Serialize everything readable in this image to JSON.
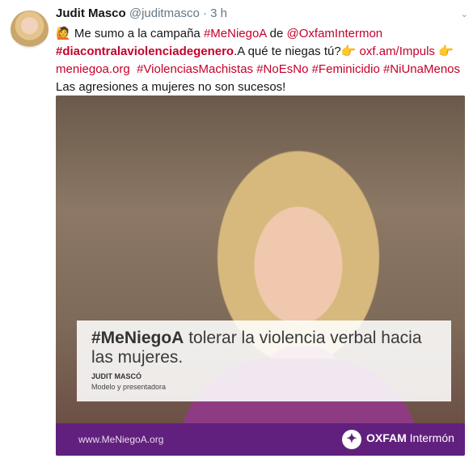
{
  "tweet": {
    "author_name": "Judit Masco",
    "handle": "@juditmasco",
    "separator": "·",
    "time": "3 h",
    "text": {
      "emoji": "🙋",
      "part1": " Me sumo a la campaña ",
      "hashtag_meniegoa": "#MeNiegoA",
      "part2": " de ",
      "mention_oxfam": "@OxfamIntermon",
      "hashtag_dia": "#diacontralaviolenciadegenero",
      "part3": ".A qué te niegas tú?",
      "point_emoji": "👉",
      "link_impuls": "oxf.am/Impuls",
      "point_emoji2": "👉",
      "link_meniegoa": "meniegoa.org",
      "hashtag_violencias": "#ViolenciasMachistas",
      "hashtag_noesno": "#NoEsNo",
      "hashtag_feminicidio": "#Feminicidio",
      "hashtag_niunamenos": "#NiUnaMenos",
      "part4": " Las agresiones a mujeres no son sucesos!"
    }
  },
  "card": {
    "overlay_hashtag": "#MeNiegoA",
    "overlay_text": " tolerar la violencia verbal hacia las mujeres.",
    "person_name": "JUDIT MASCÓ",
    "person_role": "Modelo y presentadora",
    "website": "www.MeNiegoA.org",
    "logo_brand": "OXFAM",
    "logo_sub": " Intermón"
  },
  "colors": {
    "link": "#c4002b",
    "footer": "#61207d"
  }
}
